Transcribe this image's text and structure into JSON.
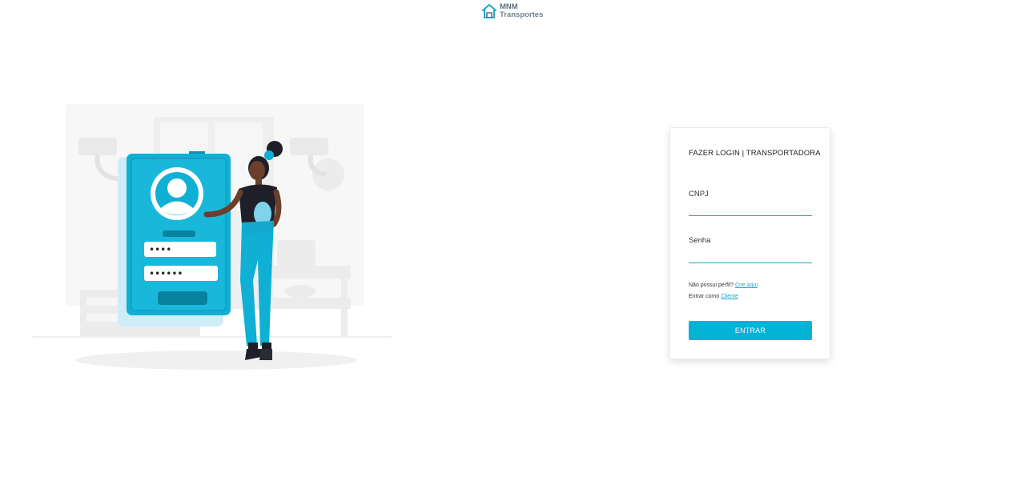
{
  "brand": {
    "line1": "MNM",
    "line2": "Transportes",
    "icon": "house-icon",
    "color": "#1aa7cb"
  },
  "illustration": {
    "icon": "login-illustration",
    "mask_short": "••••",
    "mask_long": "••••••"
  },
  "login": {
    "title": "FAZER LOGIN | TRANSPORTADORA",
    "cnpj_label": "CNPJ",
    "cnpj_value": "",
    "password_label": "Senha",
    "password_value": "",
    "signup_prefix": "Não possui perfil?",
    "signup_link": "Crie aqui",
    "client_prefix": "Entrar como",
    "client_link": "Cliente",
    "submit_label": "ENTRAR"
  },
  "colors": {
    "accent": "#02b3d6",
    "link": "#1aa7cb",
    "input_underline": "#19a7c9"
  }
}
